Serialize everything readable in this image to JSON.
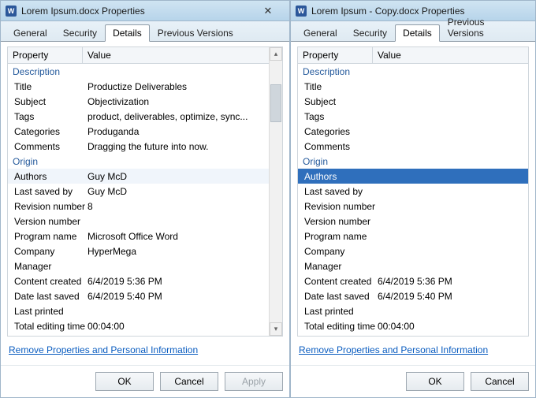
{
  "left": {
    "title": "Lorem Ipsum.docx Properties",
    "tabs": [
      "General",
      "Security",
      "Details",
      "Previous Versions"
    ],
    "active_tab": "Details",
    "headers": {
      "c1": "Property",
      "c2": "Value"
    },
    "groups": [
      {
        "label": "Description",
        "rows": [
          {
            "k": "Title",
            "v": "Productize Deliverables"
          },
          {
            "k": "Subject",
            "v": "Objectivization"
          },
          {
            "k": "Tags",
            "v": "product, deliverables, optimize, sync..."
          },
          {
            "k": "Categories",
            "v": "Produganda"
          },
          {
            "k": "Comments",
            "v": "Dragging the future into now."
          }
        ]
      },
      {
        "label": "Origin",
        "rows": [
          {
            "k": "Authors",
            "v": "Guy McD",
            "highlight": true
          },
          {
            "k": "Last saved by",
            "v": "Guy McD"
          },
          {
            "k": "Revision number",
            "v": "8"
          },
          {
            "k": "Version number",
            "v": ""
          },
          {
            "k": "Program name",
            "v": "Microsoft Office Word"
          },
          {
            "k": "Company",
            "v": "HyperMega"
          },
          {
            "k": "Manager",
            "v": ""
          },
          {
            "k": "Content created",
            "v": "6/4/2019 5:36 PM"
          },
          {
            "k": "Date last saved",
            "v": "6/4/2019 5:40 PM"
          },
          {
            "k": "Last printed",
            "v": ""
          },
          {
            "k": "Total editing time",
            "v": "00:04:00"
          }
        ]
      }
    ],
    "link": "Remove Properties and Personal Information",
    "buttons": {
      "ok": "OK",
      "cancel": "Cancel",
      "apply": "Apply"
    }
  },
  "right": {
    "title": "Lorem Ipsum - Copy.docx Properties",
    "tabs": [
      "General",
      "Security",
      "Details",
      "Previous Versions"
    ],
    "active_tab": "Details",
    "headers": {
      "c1": "Property",
      "c2": "Value"
    },
    "groups": [
      {
        "label": "Description",
        "rows": [
          {
            "k": "Title",
            "v": ""
          },
          {
            "k": "Subject",
            "v": ""
          },
          {
            "k": "Tags",
            "v": ""
          },
          {
            "k": "Categories",
            "v": ""
          },
          {
            "k": "Comments",
            "v": ""
          }
        ]
      },
      {
        "label": "Origin",
        "rows": [
          {
            "k": "Authors",
            "v": "",
            "selected": true
          },
          {
            "k": "Last saved by",
            "v": ""
          },
          {
            "k": "Revision number",
            "v": ""
          },
          {
            "k": "Version number",
            "v": ""
          },
          {
            "k": "Program name",
            "v": ""
          },
          {
            "k": "Company",
            "v": ""
          },
          {
            "k": "Manager",
            "v": ""
          },
          {
            "k": "Content created",
            "v": "6/4/2019 5:36 PM"
          },
          {
            "k": "Date last saved",
            "v": "6/4/2019 5:40 PM"
          },
          {
            "k": "Last printed",
            "v": ""
          },
          {
            "k": "Total editing time",
            "v": "00:04:00"
          }
        ]
      }
    ],
    "link": "Remove Properties and Personal Information",
    "buttons": {
      "ok": "OK",
      "cancel": "Cancel"
    }
  },
  "word_icon_letter": "W",
  "close_glyph": "✕"
}
